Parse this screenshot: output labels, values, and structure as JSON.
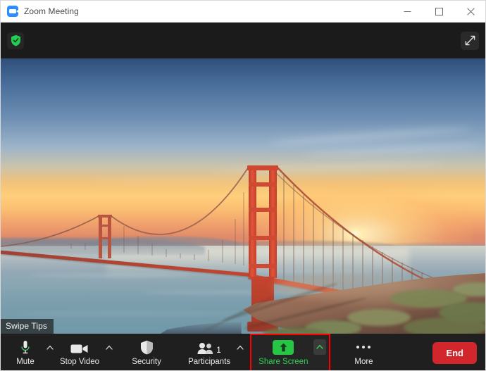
{
  "window": {
    "title": "Zoom Meeting",
    "logo_icon": "zoom-camera-icon",
    "controls": {
      "minimize_icon": "minimize-icon",
      "maximize_icon": "maximize-icon",
      "close_icon": "close-icon"
    }
  },
  "meeting_topbar": {
    "encryption_icon": "green-shield-check-icon",
    "expand_icon": "fullscreen-expand-icon"
  },
  "video": {
    "overlay_label": "Swipe Tips",
    "scene_description": "Golden Gate Bridge at sunset over San Francisco Bay with rocky headland"
  },
  "toolbar": {
    "items": [
      {
        "label": "Mute",
        "icon": "microphone-icon",
        "has_chevron": true,
        "badge": ""
      },
      {
        "label": "Stop Video",
        "icon": "video-camera-icon",
        "has_chevron": true,
        "badge": ""
      },
      {
        "label": "Security",
        "icon": "shield-icon",
        "has_chevron": false,
        "badge": ""
      },
      {
        "label": "Participants",
        "icon": "people-icon",
        "has_chevron": true,
        "badge": "1"
      },
      {
        "label": "Share Screen",
        "icon": "share-arrow-up-icon",
        "has_chevron": true,
        "badge": ""
      },
      {
        "label": "More",
        "icon": "ellipsis-icon",
        "has_chevron": false,
        "badge": ""
      }
    ],
    "end_button": "End"
  },
  "colors": {
    "accent_green": "#2fd153",
    "share_icon_green": "#27c544",
    "highlight_red": "#ff0000",
    "end_red": "#d0262c",
    "toolbar_bg": "#1f1f1f",
    "titlebar_bg": "#ffffff",
    "zoom_blue": "#2d8cff"
  }
}
